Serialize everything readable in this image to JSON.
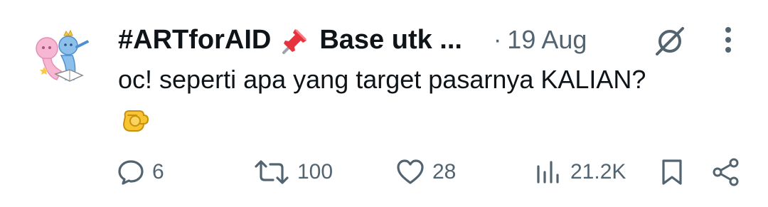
{
  "tweet": {
    "author": {
      "display_name": "#ARTforAID",
      "name_suffix": "Base utk ...",
      "avatar": "illustrated-characters-avatar"
    },
    "separator": "·",
    "date": "19 Aug",
    "text": "oc! seperti apa yang target pasarnya KALIAN?",
    "emoji": "backhand-index-pointing-at-viewer",
    "header_icons": [
      "grok-icon",
      "more-vertical-icon"
    ]
  },
  "actions": {
    "reply": {
      "icon": "reply-icon",
      "count": "6"
    },
    "repost": {
      "icon": "repost-icon",
      "count": "100"
    },
    "like": {
      "icon": "heart-icon",
      "count": "28"
    },
    "views": {
      "icon": "views-icon",
      "count": "21.2K"
    },
    "bookmark": {
      "icon": "bookmark-icon"
    },
    "share": {
      "icon": "share-icon"
    }
  },
  "colors": {
    "text_primary": "#0f1419",
    "text_secondary": "#536471"
  }
}
